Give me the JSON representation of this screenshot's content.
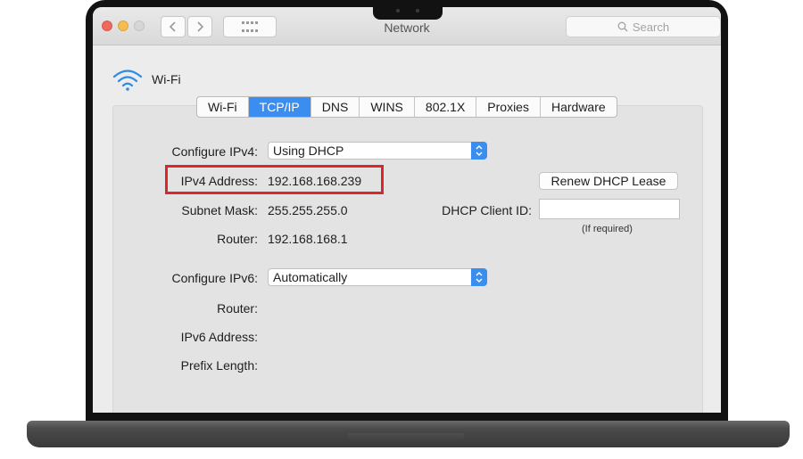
{
  "window": {
    "title": "Network",
    "search_placeholder": "Search"
  },
  "interface": {
    "name": "Wi-Fi",
    "icon": "wifi-icon"
  },
  "tabs": [
    {
      "label": "Wi-Fi",
      "active": false
    },
    {
      "label": "TCP/IP",
      "active": true
    },
    {
      "label": "DNS",
      "active": false
    },
    {
      "label": "WINS",
      "active": false
    },
    {
      "label": "802.1X",
      "active": false
    },
    {
      "label": "Proxies",
      "active": false
    },
    {
      "label": "Hardware",
      "active": false
    }
  ],
  "ipv4": {
    "configure_label": "Configure IPv4:",
    "configure_value": "Using DHCP",
    "address_label": "IPv4 Address:",
    "address_value": "192.168.168.239",
    "subnet_label": "Subnet Mask:",
    "subnet_value": "255.255.255.0",
    "router_label": "Router:",
    "router_value": "192.168.168.1"
  },
  "dhcp": {
    "renew_label": "Renew DHCP Lease",
    "client_id_label": "DHCP Client ID:",
    "client_id_value": "",
    "hint": "(If required)"
  },
  "ipv6": {
    "configure_label": "Configure IPv6:",
    "configure_value": "Automatically",
    "router_label": "Router:",
    "address_label": "IPv6 Address:",
    "prefix_label": "Prefix Length:"
  },
  "colors": {
    "accent": "#3b8ef0",
    "highlight_box": "#d9272b",
    "close": "#ee6a5f",
    "minimize": "#f5bd4f",
    "zoom": "#d6d6d6"
  }
}
